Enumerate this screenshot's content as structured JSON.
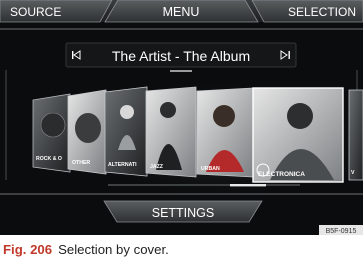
{
  "header": {
    "source_label": "SOURCE",
    "menu_label": "MENU",
    "selection_label": "SELECTION"
  },
  "now_playing": {
    "title": "The Artist - The Album",
    "prev_icon": "skip-previous-icon",
    "next_icon": "skip-next-icon"
  },
  "covers": [
    {
      "label": "ROCK & O"
    },
    {
      "label": "OTHER"
    },
    {
      "label": "ALTERNATI"
    },
    {
      "label": "JAZZ"
    },
    {
      "label": "URBAN"
    },
    {
      "label": "ELECTRONICA"
    },
    {
      "label": "V"
    }
  ],
  "footer": {
    "settings_label": "SETTINGS"
  },
  "image_code": "B5F-0915",
  "caption": {
    "fig_label": "Fig. 206",
    "text": "Selection by cover."
  },
  "colors": {
    "screen_bg": "#0b0c0d",
    "accent": "#c0392b",
    "tab": "#444849"
  }
}
